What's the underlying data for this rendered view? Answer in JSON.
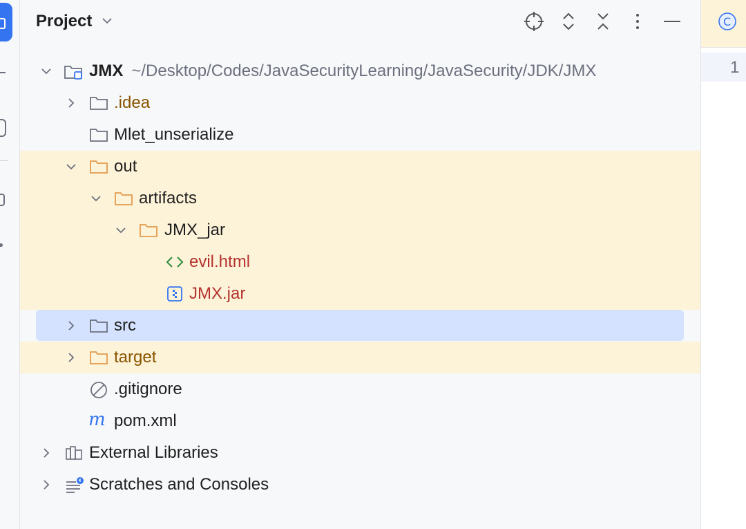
{
  "panel": {
    "title": "Project",
    "header_buttons": [
      "locate-icon",
      "expand-all-icon",
      "collapse-all-icon",
      "more-options-icon",
      "hide-icon"
    ]
  },
  "tree": {
    "root": {
      "name": "JMX",
      "path": "~/Desktop/Codes/JavaSecurityLearning/JavaSecurity/JDK/JMX",
      "icon": "module-folder-icon"
    },
    "items": [
      {
        "label": ".idea",
        "icon": "folder-icon",
        "expandable": true,
        "expanded": false,
        "color": "#8a5500",
        "state": "excluded"
      },
      {
        "label": "Mlet_unserialize",
        "icon": "folder-icon",
        "expandable": false,
        "color": "#1f1f1f"
      },
      {
        "label": "out",
        "icon": "folder-icon",
        "expandable": true,
        "expanded": true,
        "color": "#1f1f1f",
        "state": "excluded"
      },
      {
        "label": "artifacts",
        "icon": "folder-icon",
        "expandable": true,
        "expanded": true,
        "color": "#1f1f1f",
        "state": "excluded"
      },
      {
        "label": "JMX_jar",
        "icon": "folder-icon",
        "expandable": true,
        "expanded": true,
        "color": "#1f1f1f",
        "state": "excluded"
      },
      {
        "label": "evil.html",
        "icon": "html-icon",
        "expandable": false,
        "color": "#b5332e",
        "state": "excluded"
      },
      {
        "label": "JMX.jar",
        "icon": "jar-icon",
        "expandable": false,
        "color": "#b5332e",
        "state": "excluded"
      },
      {
        "label": "src",
        "icon": "folder-icon",
        "expandable": true,
        "expanded": false,
        "color": "#1f1f1f",
        "state": "selected"
      },
      {
        "label": "target",
        "icon": "folder-icon",
        "expandable": true,
        "expanded": false,
        "color": "#8a5500",
        "state": "excluded"
      },
      {
        "label": ".gitignore",
        "icon": "ignore-file-icon",
        "expandable": false,
        "color": "#1f1f1f"
      },
      {
        "label": "pom.xml",
        "icon": "maven-icon",
        "expandable": false,
        "color": "#1f1f1f"
      },
      {
        "label": "External Libraries",
        "icon": "library-icon",
        "expandable": true,
        "expanded": false,
        "color": "#1f1f1f"
      },
      {
        "label": "Scratches and Consoles",
        "icon": "scratches-icon",
        "expandable": true,
        "expanded": false,
        "color": "#1f1f1f"
      }
    ]
  },
  "editor": {
    "tab_icon": "class-icon",
    "line_number": "1"
  },
  "colors": {
    "accent": "#3574f0",
    "excluded_bg": "#fdf3d9",
    "selected_bg": "#d4e2ff",
    "folder_orange": "#e39a4b",
    "folder_gray": "#6c707e",
    "html_green": "#2c8a3b"
  }
}
